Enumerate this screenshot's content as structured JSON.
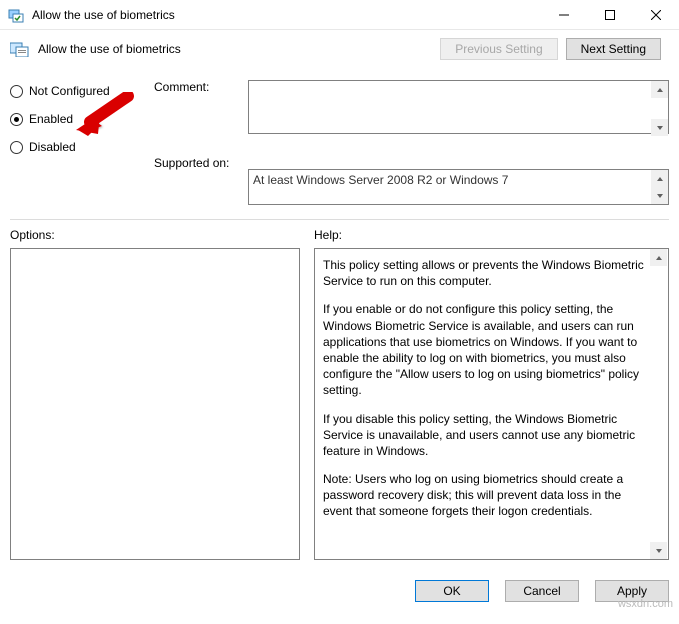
{
  "window": {
    "title": "Allow the use of biometrics"
  },
  "header": {
    "setting_name": "Allow the use of biometrics",
    "prev_button": "Previous Setting",
    "next_button": "Next Setting"
  },
  "radios": {
    "not_configured": "Not Configured",
    "enabled": "Enabled",
    "disabled": "Disabled",
    "selected": "enabled"
  },
  "labels": {
    "comment": "Comment:",
    "supported": "Supported on:",
    "options": "Options:",
    "help": "Help:"
  },
  "fields": {
    "comment_value": "",
    "supported_value": "At least Windows Server 2008 R2 or Windows 7"
  },
  "help": {
    "p1": "This policy setting allows or prevents the Windows Biometric Service to run on this computer.",
    "p2": "If you enable or do not configure this policy setting, the Windows Biometric Service is available, and users can run applications that use biometrics on Windows. If you want to enable the ability to log on with biometrics, you must also configure the \"Allow users to log on using biometrics\" policy setting.",
    "p3": "If you disable this policy setting, the Windows Biometric Service is unavailable, and users cannot use any biometric feature in Windows.",
    "p4": "Note: Users who log on using biometrics should create a password recovery disk; this will prevent data loss in the event that someone forgets their logon credentials."
  },
  "footer": {
    "ok": "OK",
    "cancel": "Cancel",
    "apply": "Apply"
  },
  "watermark": "wsxdn.com"
}
